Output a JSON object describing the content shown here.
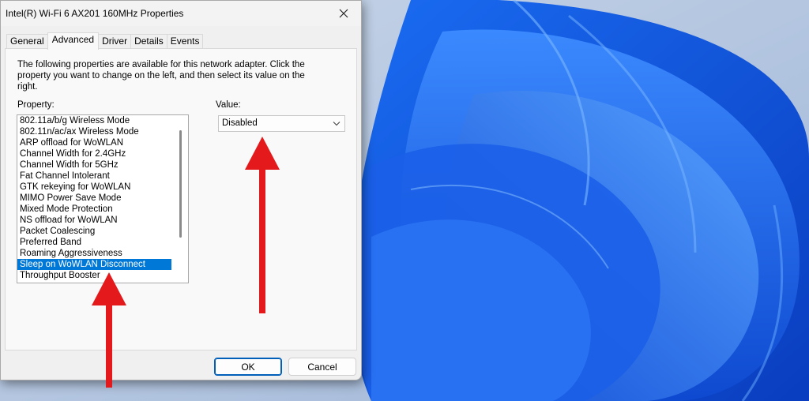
{
  "window": {
    "title": "Intel(R) Wi-Fi 6 AX201 160MHz Properties"
  },
  "tabs": [
    {
      "label": "General",
      "active": false
    },
    {
      "label": "Advanced",
      "active": true
    },
    {
      "label": "Driver",
      "active": false
    },
    {
      "label": "Details",
      "active": false
    },
    {
      "label": "Events",
      "active": false
    }
  ],
  "advanced": {
    "description": "The following properties are available for this network adapter. Click the property you want to change on the left, and then select its value on the right.",
    "property_label": "Property:",
    "value_label": "Value:",
    "properties": [
      "802.11a/b/g Wireless Mode",
      "802.11n/ac/ax Wireless Mode",
      "ARP offload for WoWLAN",
      "Channel Width for 2.4GHz",
      "Channel Width for 5GHz",
      "Fat Channel Intolerant",
      "GTK rekeying for WoWLAN",
      "MIMO Power Save Mode",
      "Mixed Mode Protection",
      "NS offload for WoWLAN",
      "Packet Coalescing",
      "Preferred Band",
      "Roaming Aggressiveness",
      "Sleep on WoWLAN Disconnect",
      "Throughput Booster"
    ],
    "selected_property": "Sleep on WoWLAN Disconnect",
    "value": "Disabled"
  },
  "buttons": {
    "ok": "OK",
    "cancel": "Cancel"
  },
  "colors": {
    "selection": "#0078d7",
    "annotation_arrow": "#e3191b",
    "wallpaper_blue": "#1f5fe0"
  }
}
